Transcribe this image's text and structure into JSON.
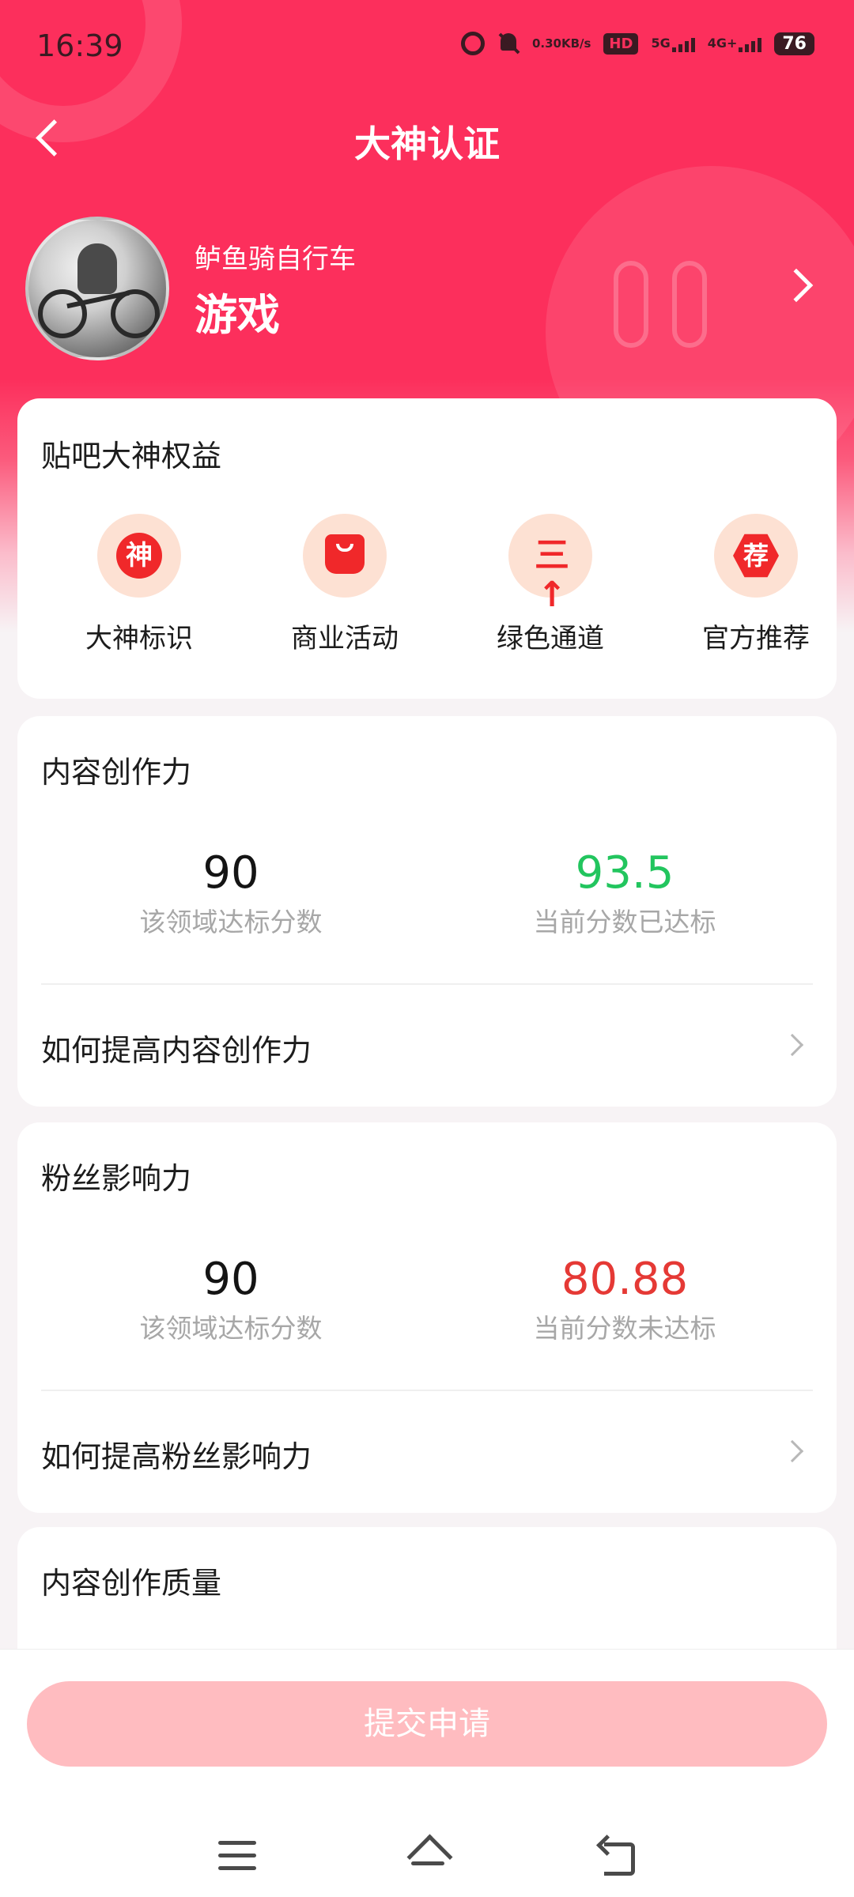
{
  "status_bar": {
    "time": "16:39",
    "net_speed_value": "0.30",
    "net_speed_unit": "KB/s",
    "hd_label": "HD",
    "signal_5g": "5G",
    "signal_4g": "4G+",
    "battery": "76"
  },
  "header": {
    "title": "大神认证"
  },
  "profile": {
    "name": "鲈鱼骑自行车",
    "domain": "游戏"
  },
  "benefits": {
    "title": "贴吧大神权益",
    "items": [
      {
        "label": "大神标识",
        "icon": "shen-badge-icon",
        "glyph": "神"
      },
      {
        "label": "商业活动",
        "icon": "shopping-bag-icon",
        "glyph": ""
      },
      {
        "label": "绿色通道",
        "icon": "fast-track-icon",
        "glyph": "三↑"
      },
      {
        "label": "官方推荐",
        "icon": "recommend-badge-icon",
        "glyph": "荐"
      }
    ]
  },
  "sections": [
    {
      "title": "内容创作力",
      "standard_value": "90",
      "standard_caption": "该领域达标分数",
      "current_value": "93.5",
      "current_caption": "当前分数已达标",
      "status": "met",
      "link_text": "如何提高内容创作力"
    },
    {
      "title": "粉丝影响力",
      "standard_value": "90",
      "standard_caption": "该领域达标分数",
      "current_value": "80.88",
      "current_caption": "当前分数未达标",
      "status": "not_met",
      "link_text": "如何提高粉丝影响力"
    },
    {
      "title": "内容创作质量"
    }
  ],
  "footer": {
    "submit_label": "提交申请"
  },
  "colors": {
    "brand": "#fc2f5c",
    "met": "#22c55e",
    "not_met": "#e53935",
    "submit_disabled": "#ffbcc0"
  }
}
